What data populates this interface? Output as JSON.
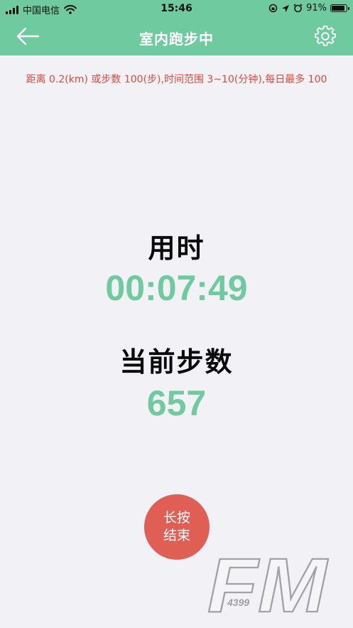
{
  "status_bar": {
    "carrier": "中国电信",
    "time": "15:46",
    "battery_percent": "91%",
    "battery_level": 0.91
  },
  "nav": {
    "title": "室内跑步中",
    "back_icon": "back-arrow-icon",
    "settings_icon": "gear-icon"
  },
  "notice": "距离 0.2(km) 或步数 100(步),时间范围 3~10(分钟),每日最多 100",
  "timer": {
    "label": "用时",
    "value": "00:07:49"
  },
  "steps": {
    "label": "当前步数",
    "value": "657"
  },
  "end_button": {
    "line1": "长按",
    "line2": "结束"
  },
  "watermark": {
    "text": "FM",
    "subtext": "4399"
  },
  "colors": {
    "accent": "#6fcb9f",
    "warning": "#e5473a",
    "end_button": "#df5f55",
    "background": "#f2f1f6"
  }
}
